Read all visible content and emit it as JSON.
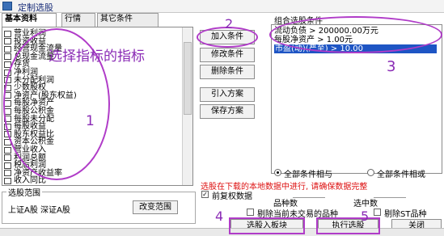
{
  "window": {
    "title": "定制选股"
  },
  "tabs": [
    {
      "label": "基本资料"
    },
    {
      "label": "行情"
    },
    {
      "label": "其它条件"
    }
  ],
  "indicators": [
    "营业利润",
    "投资收益",
    "经营现金流量",
    "总现金流量",
    "存货",
    "净利润",
    "未分配利润",
    "少数股权",
    "净资产(股东权益)",
    "每股净资产",
    "每股公积金",
    "每股未分配",
    "每股收益",
    "股东权益比",
    "资本公积金",
    "营业收入",
    "利润总额",
    "税后利润",
    "净资产收益率",
    "收入同比"
  ],
  "buttons": {
    "add": "加入条件",
    "modify": "修改条件",
    "delete": "删除条件",
    "import": "引入方案",
    "save": "保存方案",
    "change_range": "改变范围",
    "select_to_block": "选股入板块",
    "execute": "执行选股",
    "close": "关闭"
  },
  "conditions": {
    "title": "组合选股条件",
    "items": [
      {
        "text": "流动负债 > 200000.00万元",
        "selected": false
      },
      {
        "text": "每股净资产 > 1.00元",
        "selected": false
      },
      {
        "text": "市盈(动)(严至) > 10.00",
        "selected": true
      }
    ]
  },
  "range": {
    "title": "选股范围",
    "text": "上证A股 深证A股"
  },
  "options": {
    "all_and": "全部条件相与",
    "all_or": "全部条件相或",
    "notice": "选股在下载的本地数据中进行, 请确保数据完整",
    "restore_rights": "前复权数据",
    "count_label": "品种数",
    "selected_label": "选中数",
    "exclude_suspended": "剔除当前未交易的品种",
    "exclude_st": "剔除ST品种"
  },
  "annotations": {
    "handwritten_label": "选择指标的指标",
    "numbers": [
      "1",
      "2",
      "3",
      "4",
      "5"
    ]
  }
}
